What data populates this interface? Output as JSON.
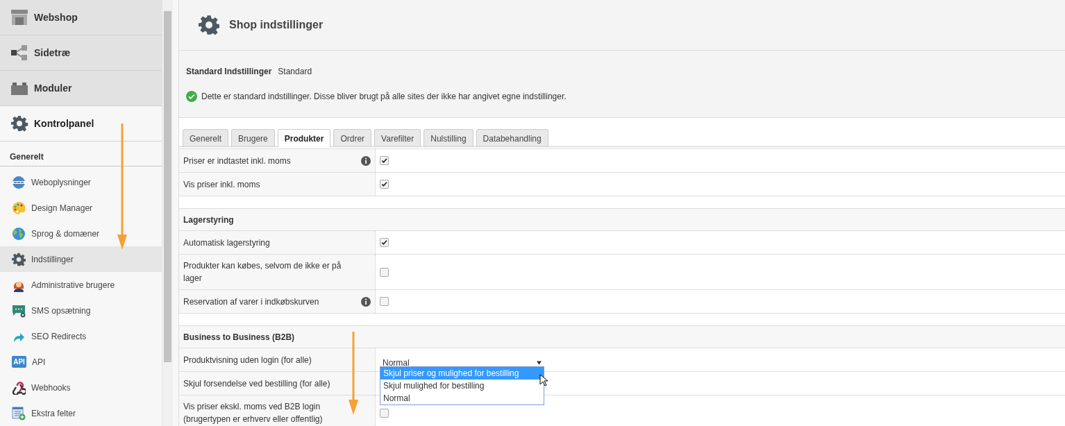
{
  "sidebar": {
    "top_items": [
      {
        "label": "Webshop",
        "selected": false
      },
      {
        "label": "Sidetræ",
        "selected": false
      },
      {
        "label": "Moduler",
        "selected": false
      },
      {
        "label": "Kontrolpanel",
        "selected": true
      }
    ],
    "section_heading": "Generelt",
    "items": [
      {
        "label": "Weboplysninger",
        "selected": false
      },
      {
        "label": "Design Manager",
        "selected": false
      },
      {
        "label": "Sprog & domæner",
        "selected": false
      },
      {
        "label": "Indstillinger",
        "selected": true
      },
      {
        "label": "Administrative brugere",
        "selected": false
      },
      {
        "label": "SMS opsætning",
        "selected": false
      },
      {
        "label": "SEO Redirects",
        "selected": false
      },
      {
        "label": "API",
        "selected": false,
        "icon_text": "API"
      },
      {
        "label": "Webhooks",
        "selected": false
      },
      {
        "label": "Ekstra felter",
        "selected": false
      }
    ]
  },
  "header": {
    "title": "Shop indstillinger"
  },
  "info": {
    "label": "Standard Indstillinger",
    "value": "Standard",
    "message": "Dette er standard indstillinger. Disse bliver brugt på alle sites der ikke har angivet egne indstillinger."
  },
  "tabs": [
    {
      "label": "Generelt",
      "selected": false
    },
    {
      "label": "Brugere",
      "selected": false
    },
    {
      "label": "Produkter",
      "selected": true
    },
    {
      "label": "Ordrer",
      "selected": false
    },
    {
      "label": "Varefilter",
      "selected": false
    },
    {
      "label": "Nulstilling",
      "selected": false
    },
    {
      "label": "Databehandling",
      "selected": false
    }
  ],
  "groups": [
    {
      "rows": [
        {
          "kind": "checkbox",
          "label": "Priser er indtastet inkl. moms",
          "info": true,
          "checked": true
        },
        {
          "kind": "checkbox",
          "label": "Vis priser inkl. moms",
          "info": false,
          "checked": true
        }
      ]
    },
    {
      "heading": "Lagerstyring",
      "rows": [
        {
          "kind": "checkbox",
          "label": "Automatisk lagerstyring",
          "info": false,
          "checked": true
        },
        {
          "kind": "checkbox",
          "label": "Produkter kan købes, selvom de ikke er på lager",
          "info": false,
          "checked": false
        },
        {
          "kind": "checkbox",
          "label": "Reservation af varer i indkøbskurven",
          "info": true,
          "checked": false
        }
      ]
    },
    {
      "heading": "Business to Business (B2B)",
      "rows": [
        {
          "kind": "select",
          "label": "Produktvisning uden login (for alle)",
          "info": false,
          "value": "Normal",
          "expanded": true,
          "options": [
            {
              "label": "Skjul priser og mulighed for bestilling",
              "highlighted": true
            },
            {
              "label": "Skjul mulighed for bestilling",
              "highlighted": false
            },
            {
              "label": "Normal",
              "highlighted": false
            }
          ]
        },
        {
          "kind": "covered",
          "label": "Skjul forsendelse ved bestilling (for alle)",
          "info": false
        },
        {
          "kind": "checkbox",
          "label": "Vis priser ekskl. moms ved B2B login (brugertypen er erhverv eller offentlig)",
          "info": false,
          "checked": false
        }
      ]
    }
  ]
}
